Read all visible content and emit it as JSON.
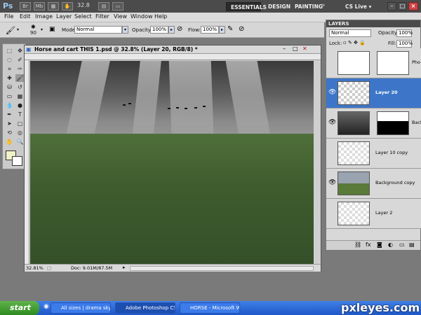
{
  "app": {
    "logo": "Ps",
    "zoom": "32.8",
    "workspaces": [
      "ESSENTIALS",
      "DESIGN",
      "PAINTING"
    ],
    "cs_live": "CS Live"
  },
  "menu": [
    "File",
    "Edit",
    "Image",
    "Layer",
    "Select",
    "Filter",
    "View",
    "Window",
    "Help"
  ],
  "options": {
    "brush_size": "90",
    "mode_label": "Mode:",
    "mode_value": "Normal",
    "opacity_label": "Opacity:",
    "opacity_value": "100%",
    "flow_label": "Flow:",
    "flow_value": "100%"
  },
  "document": {
    "title": "Horse and cart THIS 1.psd @ 32.8% (Layer 20, RGB/8) *",
    "zoom": "32.81%",
    "doc_size": "Doc: 9.01M/87.5M"
  },
  "layers_panel": {
    "title": "LAYERS",
    "blend_mode": "Normal",
    "opacity_label": "Opacity:",
    "opacity_value": "100%",
    "lock_label": "Lock:",
    "fill_label": "Fill:",
    "fill_value": "100%",
    "layers": [
      {
        "name": "Pho",
        "visible": false,
        "selected": false
      },
      {
        "name": "Layer 20",
        "visible": true,
        "selected": true
      },
      {
        "name": "Back",
        "visible": true,
        "selected": false
      },
      {
        "name": "Layer 10 copy",
        "visible": false,
        "selected": false
      },
      {
        "name": "Background copy",
        "visible": true,
        "selected": false
      },
      {
        "name": "Layer 2",
        "visible": false,
        "selected": false
      }
    ]
  },
  "taskbar": {
    "start": "start",
    "items": [
      "All sizes | drama sky |...",
      "Adobe Photoshop CS5",
      "HORSE - Microsoft W..."
    ]
  },
  "watermark": "pxleyes.com",
  "colors": {
    "title_bar": "#4b4b4b",
    "layer_selected": "#3d76c8",
    "taskbar": "#245edb",
    "start_button": "#3c9a2c"
  }
}
